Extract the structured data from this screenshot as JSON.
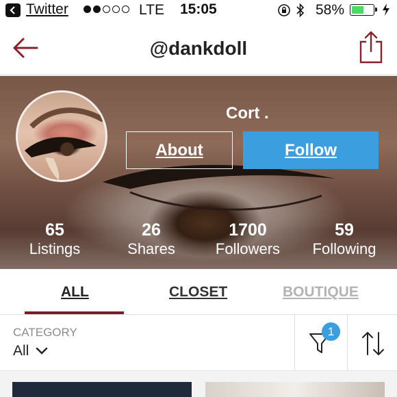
{
  "status_bar": {
    "back_app": "Twitter",
    "signal_dots_filled": 2,
    "signal_dots_total": 5,
    "carrier": "LTE",
    "time": "15:05",
    "battery_percent": "58%",
    "battery_level": 0.58
  },
  "nav": {
    "title": "@dankdoll",
    "back_icon": "back-arrow-icon",
    "share_icon": "share-icon"
  },
  "profile": {
    "name": "Cort .",
    "about_label": "About",
    "follow_label": "Follow"
  },
  "stats": [
    {
      "value": "65",
      "label": "Listings"
    },
    {
      "value": "26",
      "label": "Shares"
    },
    {
      "value": "1700",
      "label": "Followers"
    },
    {
      "value": "59",
      "label": "Following"
    }
  ],
  "tabs": [
    {
      "label": "ALL",
      "active": true
    },
    {
      "label": "CLOSET",
      "active": false
    },
    {
      "label": "BOUTIQUE",
      "active": false
    }
  ],
  "filter": {
    "category_label": "CATEGORY",
    "category_value": "All",
    "filter_badge": "1"
  },
  "colors": {
    "accent_red": "#7a1d2a",
    "follow_blue": "#3b9edf",
    "battery_green": "#4cd964"
  }
}
